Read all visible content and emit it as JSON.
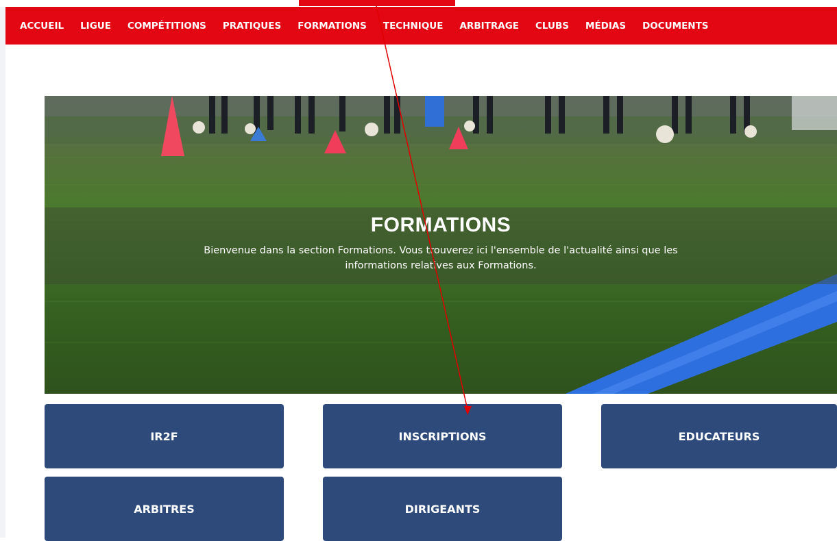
{
  "nav": {
    "items": [
      "ACCUEIL",
      "LIGUE",
      "COMPÉTITIONS",
      "PRATIQUES",
      "FORMATIONS",
      "TECHNIQUE",
      "ARBITRAGE",
      "CLUBS",
      "MÉDIAS",
      "DOCUMENTS"
    ]
  },
  "hero": {
    "title": "FORMATIONS",
    "line1": "Bienvenue dans la section Formations. Vous trouverez ici l'ensemble de l'actualité ainsi que les",
    "line2": "informations relatives aux Formations."
  },
  "tiles": [
    "IR2F",
    "INSCRIPTIONS",
    "EDUCATEURS",
    "ARBITRES",
    "DIRIGEANTS"
  ],
  "colors": {
    "nav_red": "#e30613",
    "tile_blue": "#2d4a7a",
    "annotation_red": "#e00000"
  }
}
